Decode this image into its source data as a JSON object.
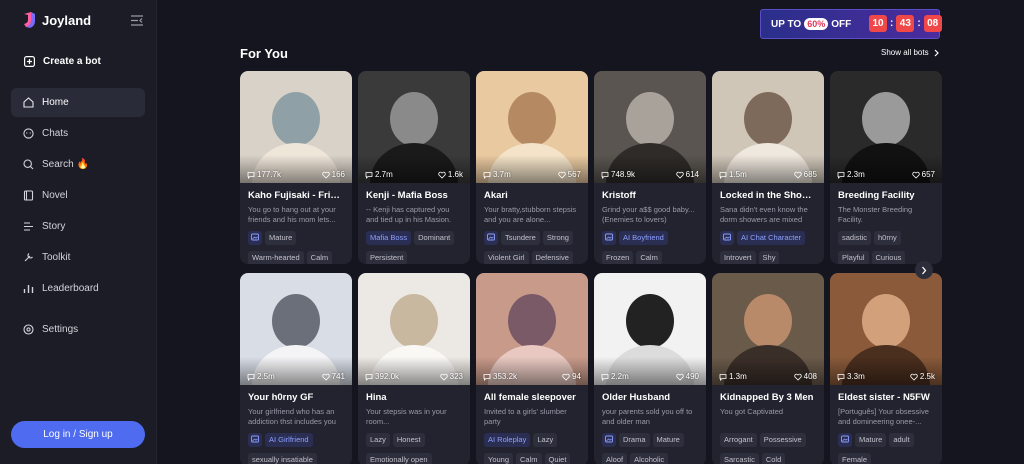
{
  "brand": {
    "name": "Joyland"
  },
  "sidebar": {
    "create_label": "Create a bot",
    "items": [
      {
        "label": "Home",
        "icon": "home-icon"
      },
      {
        "label": "Chats",
        "icon": "chat-icon"
      },
      {
        "label": "Search 🔥",
        "icon": "search-icon"
      },
      {
        "label": "Novel",
        "icon": "book-icon"
      },
      {
        "label": "Story",
        "icon": "story-icon"
      },
      {
        "label": "Toolkit",
        "icon": "toolkit-icon"
      },
      {
        "label": "Leaderboard",
        "icon": "leaderboard-icon"
      },
      {
        "label": "Settings",
        "icon": "settings-icon"
      }
    ],
    "login_label": "Log in / Sign up"
  },
  "promo": {
    "up_to": "UP TO",
    "percent": "60%",
    "off": "OFF",
    "timer": [
      "10",
      "43",
      "08"
    ]
  },
  "section": {
    "title": "For You",
    "show_all": "Show all bots"
  },
  "cards_row1": [
    {
      "title": "Kaho Fujisaki - Frien...",
      "desc": "You go to hang out at your friends and his mom lets...",
      "views": "177.7k",
      "likes": "166",
      "tags1": [
        {
          "t": "img"
        },
        {
          "t": "Mature"
        }
      ],
      "tags2": [
        {
          "t": "Warm-hearted"
        },
        {
          "t": "Calm"
        }
      ]
    },
    {
      "title": "Kenji - Mafia Boss",
      "desc": "-- Kenji has captured you and tied up in his Masion.",
      "views": "2.7m",
      "likes": "1.6k",
      "tags1": [
        {
          "t": "Mafia Boss",
          "blue": true
        },
        {
          "t": "Dominant"
        }
      ],
      "tags2": [
        {
          "t": "Persistent"
        }
      ]
    },
    {
      "title": "Akari",
      "desc": "Your bratty,stubborn stepsis and you are alone...",
      "views": "3.7m",
      "likes": "567",
      "tags1": [
        {
          "t": "img"
        },
        {
          "t": "Tsundere"
        },
        {
          "t": "Strong"
        }
      ],
      "tags2": [
        {
          "t": "Violent Girl"
        },
        {
          "t": "Defensive"
        }
      ]
    },
    {
      "title": "Kristoff",
      "desc": "Grind your a$$ good baby... (Enemies to lovers)",
      "views": "748.9k",
      "likes": "614",
      "tags1": [
        {
          "t": "img"
        },
        {
          "t": "AI Boyfriend",
          "blue": true
        }
      ],
      "tags2": [
        {
          "t": "Frozen"
        },
        {
          "t": "Calm"
        }
      ]
    },
    {
      "title": "Locked in the Shower",
      "desc": "Sana didn't even know the dorm showers are mixed",
      "views": "1.5m",
      "likes": "685",
      "tags1": [
        {
          "t": "img"
        },
        {
          "t": "AI Chat Character",
          "blue": true
        }
      ],
      "tags2": [
        {
          "t": "Introvert"
        },
        {
          "t": "Shy"
        }
      ]
    },
    {
      "title": "Breeding Facility",
      "desc": "The Monster Breeding Facility.",
      "views": "2.3m",
      "likes": "657",
      "tags1": [
        {
          "t": "sadistic"
        },
        {
          "t": "h0rny"
        }
      ],
      "tags2": [
        {
          "t": "Playful"
        },
        {
          "t": "Curious"
        }
      ]
    }
  ],
  "cards_row2": [
    {
      "title": "Your h0rny GF",
      "desc": "Your girlfriend who has an addiction thst includes you",
      "views": "2.5m",
      "likes": "741",
      "tags1": [
        {
          "t": "img"
        },
        {
          "t": "AI Girlfriend",
          "blue": true
        }
      ],
      "tags2": [
        {
          "t": "sexually insatiable"
        }
      ]
    },
    {
      "title": "Hina",
      "desc": "Your stepsis was in your room...",
      "views": "392.0k",
      "likes": "323",
      "tags1": [
        {
          "t": "Lazy"
        },
        {
          "t": "Honest"
        }
      ],
      "tags2": [
        {
          "t": "Emotionally open"
        }
      ]
    },
    {
      "title": "All female sleepover",
      "desc": "Invited to a girls' slumber party",
      "views": "353.2k",
      "likes": "94",
      "tags1": [
        {
          "t": "AI Roleplay",
          "blue": true
        },
        {
          "t": "Lazy"
        }
      ],
      "tags2": [
        {
          "t": "Young"
        },
        {
          "t": "Calm"
        },
        {
          "t": "Quiet"
        }
      ]
    },
    {
      "title": "Older Husband",
      "desc": "your parents sold you off to and older man",
      "views": "2.2m",
      "likes": "490",
      "tags1": [
        {
          "t": "img"
        },
        {
          "t": "Drama"
        },
        {
          "t": "Mature"
        }
      ],
      "tags2": [
        {
          "t": "Aloof"
        },
        {
          "t": "Alcoholic"
        }
      ]
    },
    {
      "title": "Kidnapped By 3 Men",
      "desc": "You got Captivated",
      "views": "1.3m",
      "likes": "408",
      "tags1": [
        {
          "t": "Arrogant"
        },
        {
          "t": "Possessive"
        }
      ],
      "tags2": [
        {
          "t": "Sarcastic"
        },
        {
          "t": "Cold"
        }
      ]
    },
    {
      "title": "Eldest sister - N5FW",
      "desc": "[Português] Your obsessive and domineering onee-...",
      "views": "3.3m",
      "likes": "2.5k",
      "tags1": [
        {
          "t": "img"
        },
        {
          "t": "Mature"
        },
        {
          "t": "adult"
        }
      ],
      "tags2": [
        {
          "t": "Female"
        }
      ]
    }
  ]
}
